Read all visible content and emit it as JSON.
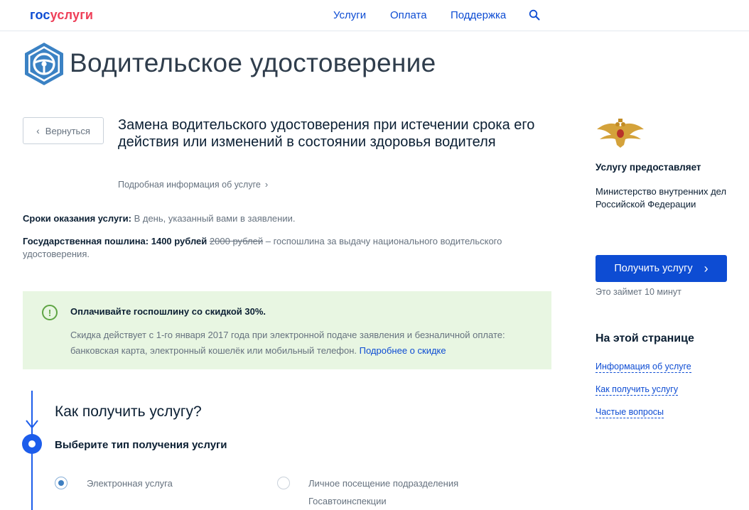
{
  "header": {
    "logo_part1": "гос",
    "logo_part2": "услуги",
    "nav": [
      "Услуги",
      "Оплата",
      "Поддержка"
    ],
    "search_icon": "search-icon"
  },
  "page": {
    "title": "Водительское удостоверение",
    "title_icon": "steering-wheel-icon"
  },
  "service": {
    "back_label": "Вернуться",
    "title": "Замена водительского удостоверения при истечении срока его действия или изменений в состоянии здоровья водителя",
    "more_info": "Подробная информация об услуге",
    "terms_label": "Сроки оказания услуги:",
    "terms_value": " В день, указанный вами в заявлении.",
    "fee_label": "Государственная пошлина: 1400 рублей",
    "fee_old": "2000 рублей",
    "fee_desc": " – госпошлина за выдачу национального водительского удостоверения."
  },
  "notice": {
    "icon": "exclamation-icon",
    "icon_glyph": "!",
    "title": "Оплачивайте госпошлину со скидкой 30%.",
    "text": "Скидка действует с 1-го января 2017 года при электронной подаче заявления и безналичной оплате: банковская карта, электронный кошелёк или мобильный телефон. ",
    "link": "Подробнее о скидке",
    "bg_color": "#e8f6e2"
  },
  "steps": {
    "heading": "Как получить услугу?",
    "step1_title": "Выберите тип получения услуги",
    "options": [
      {
        "label": "Электронная услуга",
        "selected": true
      },
      {
        "label": "Личное посещение подразделения Госавтоинспекции",
        "selected": false
      }
    ]
  },
  "sidebar": {
    "provider_heading": "Услугу предоставляет",
    "provider_name": "Министерство внутренних дел Российской Федерации",
    "get_button": "Получить услугу",
    "time_note": "Это займет 10 минут",
    "onpage_heading": "На этой странице",
    "onpage_links": [
      "Информация об услуге",
      "Как получить услугу",
      "Частые вопросы"
    ]
  },
  "colors": {
    "brand_blue": "#0d4cd3",
    "brand_red": "#ee3f58",
    "step_blue": "#1d5deb"
  }
}
